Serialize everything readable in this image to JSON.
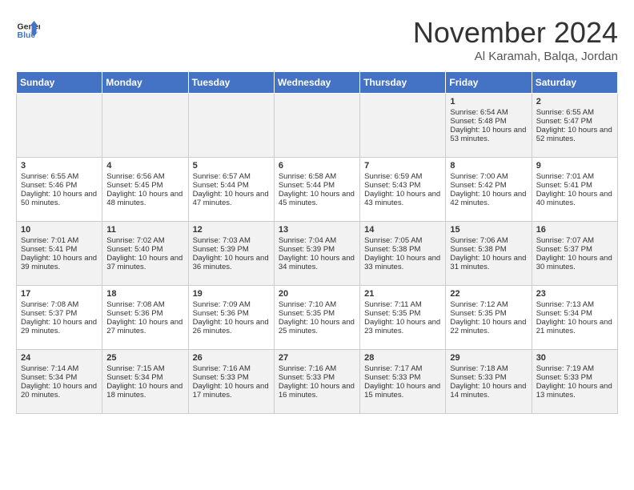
{
  "header": {
    "logo_line1": "General",
    "logo_line2": "Blue",
    "month": "November 2024",
    "location": "Al Karamah, Balqa, Jordan"
  },
  "days_of_week": [
    "Sunday",
    "Monday",
    "Tuesday",
    "Wednesday",
    "Thursday",
    "Friday",
    "Saturday"
  ],
  "weeks": [
    [
      {
        "day": "",
        "info": ""
      },
      {
        "day": "",
        "info": ""
      },
      {
        "day": "",
        "info": ""
      },
      {
        "day": "",
        "info": ""
      },
      {
        "day": "",
        "info": ""
      },
      {
        "day": "1",
        "info": "Sunrise: 6:54 AM\nSunset: 5:48 PM\nDaylight: 10 hours and 53 minutes."
      },
      {
        "day": "2",
        "info": "Sunrise: 6:55 AM\nSunset: 5:47 PM\nDaylight: 10 hours and 52 minutes."
      }
    ],
    [
      {
        "day": "3",
        "info": "Sunrise: 6:55 AM\nSunset: 5:46 PM\nDaylight: 10 hours and 50 minutes."
      },
      {
        "day": "4",
        "info": "Sunrise: 6:56 AM\nSunset: 5:45 PM\nDaylight: 10 hours and 48 minutes."
      },
      {
        "day": "5",
        "info": "Sunrise: 6:57 AM\nSunset: 5:44 PM\nDaylight: 10 hours and 47 minutes."
      },
      {
        "day": "6",
        "info": "Sunrise: 6:58 AM\nSunset: 5:44 PM\nDaylight: 10 hours and 45 minutes."
      },
      {
        "day": "7",
        "info": "Sunrise: 6:59 AM\nSunset: 5:43 PM\nDaylight: 10 hours and 43 minutes."
      },
      {
        "day": "8",
        "info": "Sunrise: 7:00 AM\nSunset: 5:42 PM\nDaylight: 10 hours and 42 minutes."
      },
      {
        "day": "9",
        "info": "Sunrise: 7:01 AM\nSunset: 5:41 PM\nDaylight: 10 hours and 40 minutes."
      }
    ],
    [
      {
        "day": "10",
        "info": "Sunrise: 7:01 AM\nSunset: 5:41 PM\nDaylight: 10 hours and 39 minutes."
      },
      {
        "day": "11",
        "info": "Sunrise: 7:02 AM\nSunset: 5:40 PM\nDaylight: 10 hours and 37 minutes."
      },
      {
        "day": "12",
        "info": "Sunrise: 7:03 AM\nSunset: 5:39 PM\nDaylight: 10 hours and 36 minutes."
      },
      {
        "day": "13",
        "info": "Sunrise: 7:04 AM\nSunset: 5:39 PM\nDaylight: 10 hours and 34 minutes."
      },
      {
        "day": "14",
        "info": "Sunrise: 7:05 AM\nSunset: 5:38 PM\nDaylight: 10 hours and 33 minutes."
      },
      {
        "day": "15",
        "info": "Sunrise: 7:06 AM\nSunset: 5:38 PM\nDaylight: 10 hours and 31 minutes."
      },
      {
        "day": "16",
        "info": "Sunrise: 7:07 AM\nSunset: 5:37 PM\nDaylight: 10 hours and 30 minutes."
      }
    ],
    [
      {
        "day": "17",
        "info": "Sunrise: 7:08 AM\nSunset: 5:37 PM\nDaylight: 10 hours and 29 minutes."
      },
      {
        "day": "18",
        "info": "Sunrise: 7:08 AM\nSunset: 5:36 PM\nDaylight: 10 hours and 27 minutes."
      },
      {
        "day": "19",
        "info": "Sunrise: 7:09 AM\nSunset: 5:36 PM\nDaylight: 10 hours and 26 minutes."
      },
      {
        "day": "20",
        "info": "Sunrise: 7:10 AM\nSunset: 5:35 PM\nDaylight: 10 hours and 25 minutes."
      },
      {
        "day": "21",
        "info": "Sunrise: 7:11 AM\nSunset: 5:35 PM\nDaylight: 10 hours and 23 minutes."
      },
      {
        "day": "22",
        "info": "Sunrise: 7:12 AM\nSunset: 5:35 PM\nDaylight: 10 hours and 22 minutes."
      },
      {
        "day": "23",
        "info": "Sunrise: 7:13 AM\nSunset: 5:34 PM\nDaylight: 10 hours and 21 minutes."
      }
    ],
    [
      {
        "day": "24",
        "info": "Sunrise: 7:14 AM\nSunset: 5:34 PM\nDaylight: 10 hours and 20 minutes."
      },
      {
        "day": "25",
        "info": "Sunrise: 7:15 AM\nSunset: 5:34 PM\nDaylight: 10 hours and 18 minutes."
      },
      {
        "day": "26",
        "info": "Sunrise: 7:16 AM\nSunset: 5:33 PM\nDaylight: 10 hours and 17 minutes."
      },
      {
        "day": "27",
        "info": "Sunrise: 7:16 AM\nSunset: 5:33 PM\nDaylight: 10 hours and 16 minutes."
      },
      {
        "day": "28",
        "info": "Sunrise: 7:17 AM\nSunset: 5:33 PM\nDaylight: 10 hours and 15 minutes."
      },
      {
        "day": "29",
        "info": "Sunrise: 7:18 AM\nSunset: 5:33 PM\nDaylight: 10 hours and 14 minutes."
      },
      {
        "day": "30",
        "info": "Sunrise: 7:19 AM\nSunset: 5:33 PM\nDaylight: 10 hours and 13 minutes."
      }
    ]
  ]
}
